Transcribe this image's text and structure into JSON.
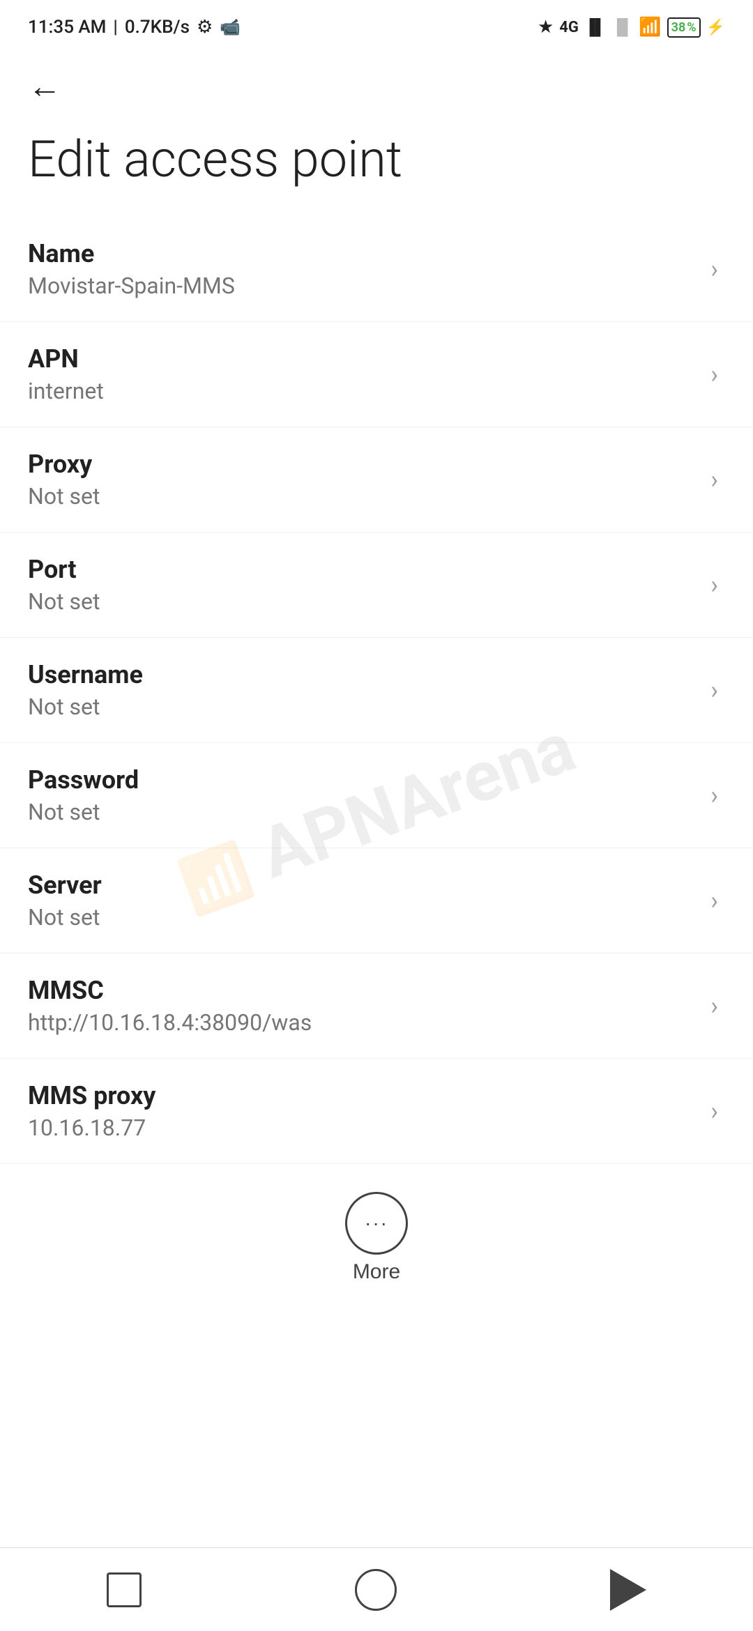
{
  "statusBar": {
    "time": "11:35 AM",
    "speed": "0.7KB/s",
    "bluetooth": "⚡",
    "battery_percent": "38"
  },
  "header": {
    "back_label": "←",
    "title": "Edit access point"
  },
  "settings": {
    "items": [
      {
        "label": "Name",
        "value": "Movistar-Spain-MMS"
      },
      {
        "label": "APN",
        "value": "internet"
      },
      {
        "label": "Proxy",
        "value": "Not set"
      },
      {
        "label": "Port",
        "value": "Not set"
      },
      {
        "label": "Username",
        "value": "Not set"
      },
      {
        "label": "Password",
        "value": "Not set"
      },
      {
        "label": "Server",
        "value": "Not set"
      },
      {
        "label": "MMSC",
        "value": "http://10.16.18.4:38090/was"
      },
      {
        "label": "MMS proxy",
        "value": "10.16.18.77"
      }
    ]
  },
  "more_button": {
    "label": "More",
    "dots": "···"
  },
  "watermark": {
    "text": "APNArena"
  },
  "nav": {
    "square_label": "recents",
    "circle_label": "home",
    "triangle_label": "back"
  }
}
